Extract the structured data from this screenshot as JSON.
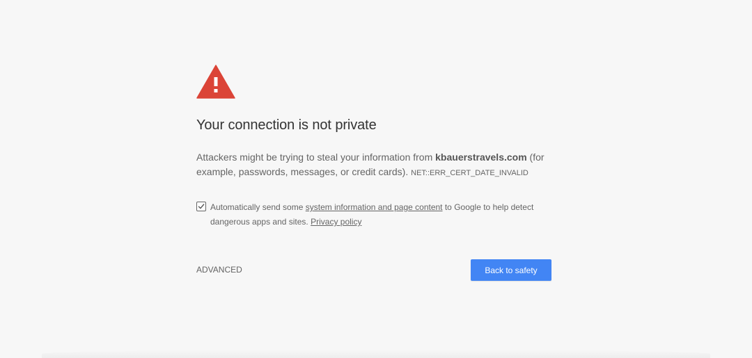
{
  "interstitial": {
    "icon": "warning-triangle-icon",
    "icon_color": "#db4437",
    "heading": "Your connection is not private",
    "explanation_prefix": "Attackers might be trying to steal your information from ",
    "domain": "kbauerstravels.com",
    "explanation_suffix": " (for example, passwords, messages, or credit cards).",
    "error_code": "NET::ERR_CERT_DATE_INVALID"
  },
  "optin": {
    "checked": true,
    "text_prefix": "Automatically send some ",
    "link_system_info": "system information and page content",
    "text_middle": " to Google to help detect dangerous apps and sites. ",
    "link_privacy": "Privacy policy"
  },
  "actions": {
    "advanced_label": "ADVANCED",
    "primary_label": "Back to safety",
    "primary_color": "#4285f4"
  }
}
